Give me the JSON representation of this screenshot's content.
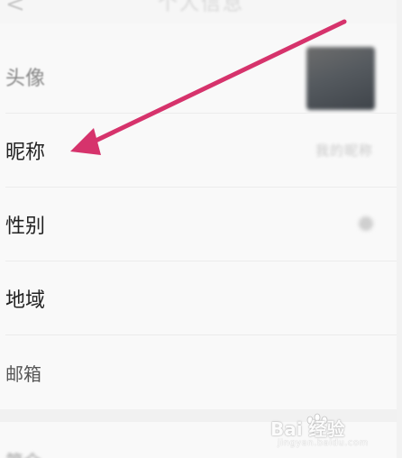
{
  "header": {
    "title": "个人信息",
    "back_glyph": "<"
  },
  "rows": [
    {
      "label": "头像"
    },
    {
      "label": "昵称",
      "value": "我的昵称"
    },
    {
      "label": "性别"
    },
    {
      "label": "地域"
    },
    {
      "label": "邮箱"
    }
  ],
  "next_row": {
    "label": "简介"
  },
  "annotation": {
    "arrow_color": "#d6336c"
  },
  "watermark": {
    "text": "Bai 经验",
    "sub": "jingyan.baidu.com"
  }
}
